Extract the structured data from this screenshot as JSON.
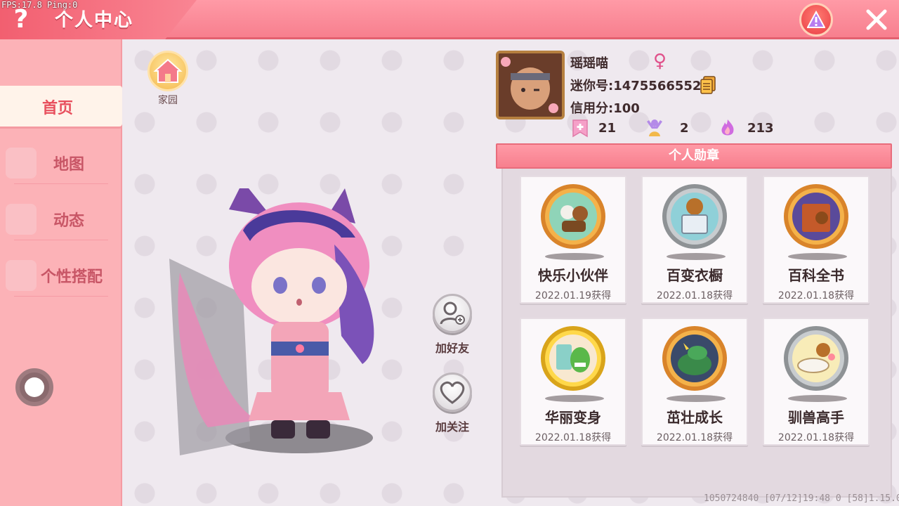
{
  "header": {
    "title": "个人中心",
    "fps": "FPS:17.8  Ping:0",
    "help_icon": "question-mark-icon",
    "warn_icon": "warning-triangle-icon",
    "close_icon": "close-icon"
  },
  "sidebar": {
    "items": [
      {
        "label": "首页",
        "active": true
      },
      {
        "label": "地图",
        "active": false
      },
      {
        "label": "动态",
        "active": false
      },
      {
        "label": "个性搭配",
        "active": false
      }
    ]
  },
  "home": {
    "label": "家园",
    "icon": "house-icon"
  },
  "actions": {
    "add_friend": "加好友",
    "follow": "加关注"
  },
  "profile": {
    "name": "瑶瑶喵",
    "gender": "♀",
    "id_text": "迷你号:1475566552",
    "credit_text": "信用分:100",
    "stats": [
      {
        "icon": "bookmark-plus-icon",
        "value": "21"
      },
      {
        "icon": "cheer-person-icon",
        "value": "2"
      },
      {
        "icon": "flame-icon",
        "value": "213"
      }
    ]
  },
  "badges": {
    "title": "个人勋章",
    "items": [
      {
        "name": "快乐小伙伴",
        "date": "2022.01.19获得",
        "rim": "gold"
      },
      {
        "name": "百变衣橱",
        "date": "2022.01.18获得",
        "rim": "silver"
      },
      {
        "name": "百科全书",
        "date": "2022.01.18获得",
        "rim": "gold"
      },
      {
        "name": "华丽变身",
        "date": "2022.01.18获得",
        "rim": "yellow"
      },
      {
        "name": "茁壮成长",
        "date": "2022.01.18获得",
        "rim": "gold"
      },
      {
        "name": "驯兽高手",
        "date": "2022.01.18获得",
        "rim": "silver"
      }
    ]
  },
  "footer": {
    "info": "1050724840   [07/12]19:48 0  [58]1.15.0"
  },
  "colors": {
    "header": "#f77f8e",
    "sidebar": "#fcb2b7",
    "accent": "#e8505e"
  }
}
